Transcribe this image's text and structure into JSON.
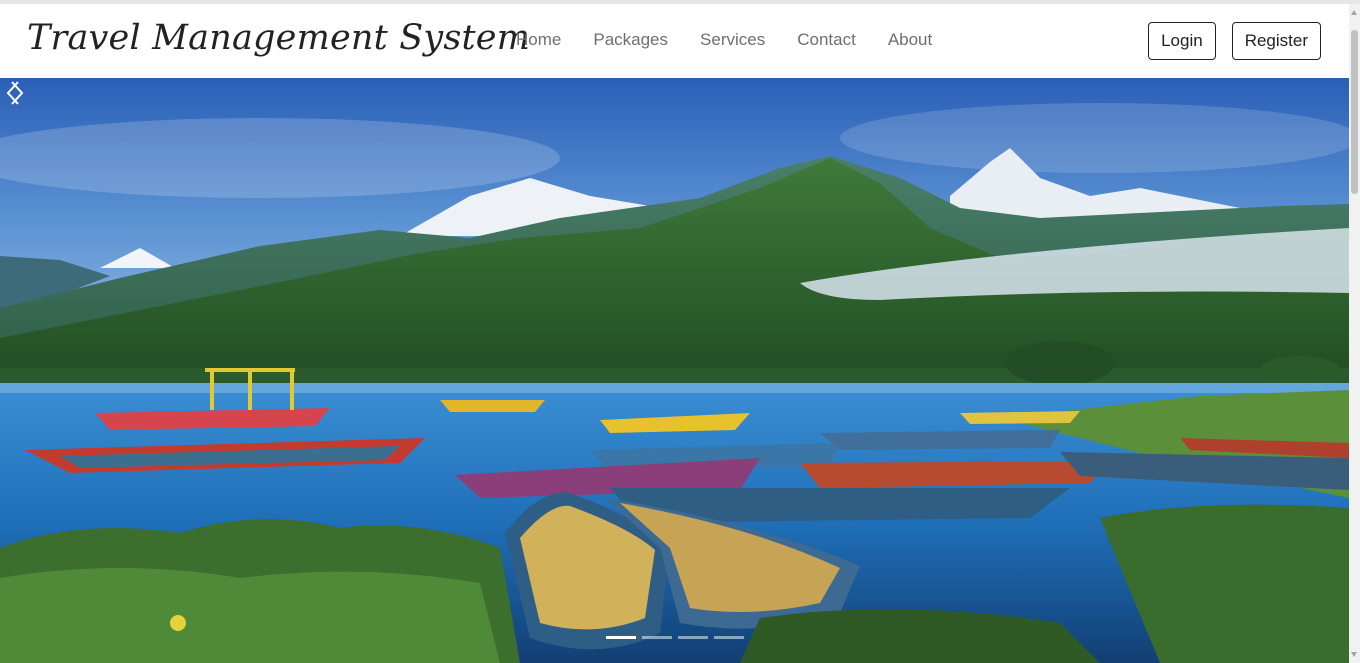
{
  "brand": {
    "title": "Travel Management System"
  },
  "nav": {
    "links": [
      {
        "label": "Home"
      },
      {
        "label": "Packages"
      },
      {
        "label": "Services"
      },
      {
        "label": "Contact"
      },
      {
        "label": "About"
      }
    ]
  },
  "auth": {
    "login_label": "Login",
    "register_label": "Register"
  },
  "carousel": {
    "slide_count": 4,
    "active_index": 0,
    "prev_icon": "chevron-left-icon",
    "next_icon": "chevron-right-icon"
  },
  "colors": {
    "navbar_bg": "#ffffff",
    "text_dark": "#222222",
    "nav_text": "#6f6f6f"
  }
}
